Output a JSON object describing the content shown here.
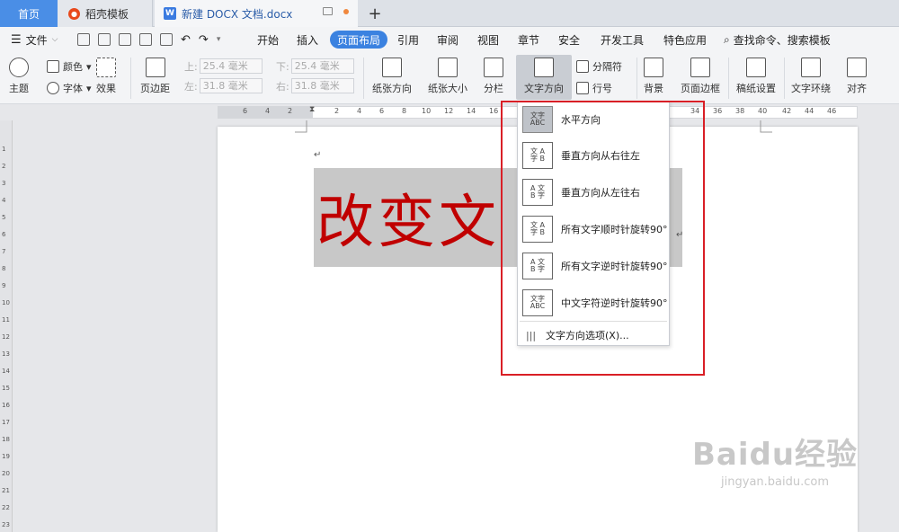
{
  "tabs": {
    "home": "首页",
    "template": "稻壳模板",
    "doc": "新建 DOCX 文档.docx",
    "new_tab": "+"
  },
  "menu": {
    "file": "文件",
    "items": [
      "开始",
      "插入",
      "页面布局",
      "引用",
      "审阅",
      "视图",
      "章节",
      "安全",
      "开发工具",
      "特色应用"
    ],
    "active_index": 2,
    "search": "查找命令、搜索模板"
  },
  "ribbon": {
    "theme": "主题",
    "color": "颜色",
    "font": "字体",
    "effect": "效果",
    "margin": "页边距",
    "top_label": "上:",
    "top_value": "25.4 毫米",
    "bottom_label": "下:",
    "bottom_value": "25.4 毫米",
    "left_label": "左:",
    "left_value": "31.8 毫米",
    "right_label": "右:",
    "right_value": "31.8 毫米",
    "orientation": "纸张方向",
    "size": "纸张大小",
    "columns": "分栏",
    "text_direction": "文字方向",
    "separator": "分隔符",
    "line_number": "行号",
    "background": "背景",
    "border": "页面边框",
    "paper": "稿纸设置",
    "wrap": "文字环绕",
    "align": "对齐"
  },
  "ruler_h": [
    "6",
    "4",
    "2",
    "",
    "2",
    "4",
    "6",
    "8",
    "10",
    "12",
    "14",
    "16",
    "18",
    "",
    "",
    "",
    "",
    "",
    "",
    "",
    "34",
    "36",
    "38",
    "40",
    "42",
    "44",
    "46"
  ],
  "ruler_v": [
    "1",
    "2",
    "3",
    "4",
    "5",
    "6",
    "7",
    "8",
    "9",
    "10",
    "11",
    "12",
    "13",
    "14",
    "15",
    "16",
    "17",
    "18",
    "19",
    "20",
    "21",
    "22",
    "23"
  ],
  "document": {
    "big_text": "改变文字方向"
  },
  "dropdown": {
    "items": [
      {
        "label": "水平方向",
        "icon": "文字\nABC",
        "icon_name": "horizontal-text-icon"
      },
      {
        "label": "垂直方向从右往左",
        "icon": "ABC 文字",
        "icon_name": "vertical-rtl-icon"
      },
      {
        "label": "垂直方向从左往右",
        "icon": "文字 ABC",
        "icon_name": "vertical-ltr-icon"
      },
      {
        "label": "所有文字顺时针旋转90°",
        "icon": "ABC 文字",
        "icon_name": "rotate-cw-icon"
      },
      {
        "label": "所有文字逆时针旋转90°",
        "icon": "ABC 文字",
        "icon_name": "rotate-ccw-icon"
      },
      {
        "label": "中文字符逆时针旋转90°",
        "icon": "文字\nABC",
        "icon_name": "cjk-rotate-icon"
      }
    ],
    "options": "文字方向选项(X)..."
  },
  "watermark": {
    "brand": "Baidu经验",
    "url": "jingyan.baidu.com"
  },
  "colors": {
    "accent": "#3b82e0",
    "highlight_box": "#d91f26",
    "big_text": "#c00000"
  }
}
